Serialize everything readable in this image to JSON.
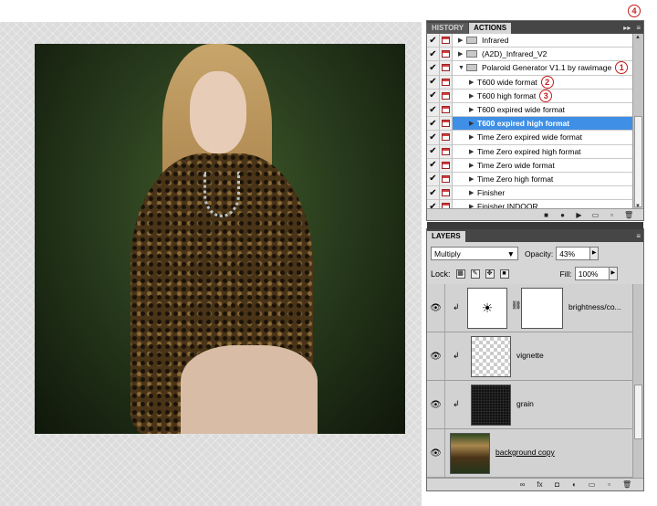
{
  "actions_panel": {
    "tabs": [
      "HISTORY",
      "ACTIONS"
    ],
    "active_tab": "ACTIONS",
    "collapse_glyph": "▸▸",
    "menu_glyph": "≡",
    "items": [
      {
        "label": "Infrared",
        "type": "set",
        "checked": true
      },
      {
        "label": "(A2D)_Infrared_V2",
        "type": "set",
        "checked": true
      },
      {
        "label": "Polaroid Generator V1.1 by rawimage",
        "type": "set",
        "expanded": true,
        "checked": true,
        "marker": "1"
      },
      {
        "label": "T600 wide format",
        "type": "action",
        "checked": true,
        "marker": "2"
      },
      {
        "label": "T600 high format",
        "type": "action",
        "checked": true,
        "marker": "3"
      },
      {
        "label": "T600 expired wide format",
        "type": "action",
        "checked": true
      },
      {
        "label": "T600 expired high format",
        "type": "action",
        "checked": true,
        "selected": true
      },
      {
        "label": "Time Zero expired wide format",
        "type": "action",
        "checked": true
      },
      {
        "label": "Time Zero expired high format",
        "type": "action",
        "checked": true
      },
      {
        "label": "Time Zero wide format",
        "type": "action",
        "checked": true
      },
      {
        "label": "Time Zero high format",
        "type": "action",
        "checked": true
      },
      {
        "label": "Finisher",
        "type": "action",
        "checked": true
      },
      {
        "label": "Finisher INDOOR",
        "type": "action",
        "checked": true
      }
    ],
    "menu_marker": "4",
    "footer_buttons": [
      "stop-icon",
      "record-icon",
      "play-icon",
      "new-set-icon",
      "new-action-icon",
      "delete-icon"
    ],
    "footer_glyphs": [
      "■",
      "●",
      "▶",
      "▭",
      "▫",
      "🗑"
    ]
  },
  "layers_panel": {
    "title": "LAYERS",
    "blend_mode": "Multiply",
    "opacity_label": "Opacity:",
    "opacity_value": "43%",
    "lock_label": "Lock:",
    "fill_label": "Fill:",
    "fill_value": "100%",
    "layers": [
      {
        "name": "brightness/co...",
        "kind": "adjustment",
        "clipped": true,
        "visible": true
      },
      {
        "name": "vignette",
        "kind": "transparent",
        "clipped": true,
        "visible": true
      },
      {
        "name": "grain",
        "kind": "dark",
        "clipped": true,
        "visible": true
      },
      {
        "name": "background copy",
        "kind": "photo",
        "clipped": false,
        "visible": true,
        "underlined": true
      }
    ],
    "footer_glyphs": [
      "∞",
      "fx",
      "◘",
      "◐",
      "▭",
      "▫",
      "🗑"
    ]
  },
  "colors": {
    "selection": "#3f8fe6",
    "marker": "#c41a1a",
    "panel": "#d6d6d6",
    "tabbar": "#464646"
  }
}
